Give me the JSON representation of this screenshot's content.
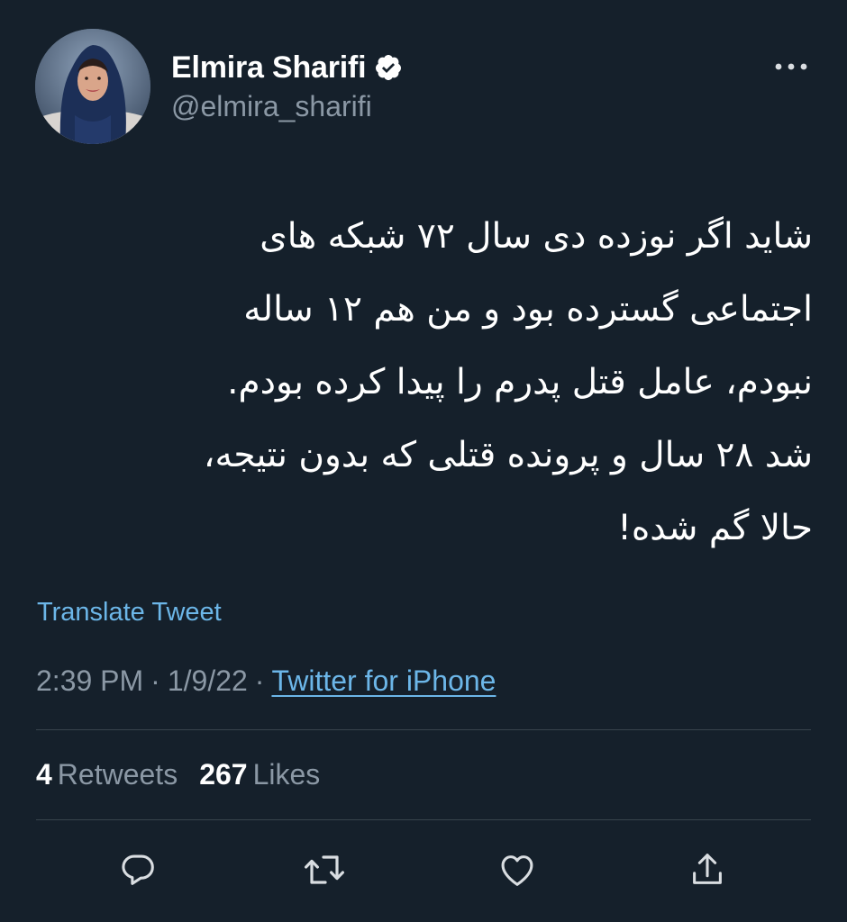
{
  "colors": {
    "background": "#15202b",
    "text_primary": "#ffffff",
    "text_secondary": "#8b98a5",
    "link": "#6cb6e8",
    "divider": "#38444d",
    "verified_badge": "#ffffff"
  },
  "author": {
    "display_name": "Elmira Sharifi",
    "handle": "@elmira_sharifi",
    "verified": true,
    "avatar_icon": "profile-photo"
  },
  "header": {
    "more_icon": "more-horizontal-icon"
  },
  "tweet": {
    "lines": [
      "شاید اگر نوزده دی سال ۷۲ شبکه های",
      "اجتماعی گسترده بود و من هم ۱۲ ساله",
      "نبودم، عامل قتل پدرم را پیدا کرده بودم.",
      "شد ۲۸ سال و پرونده قتلی که بدون نتیجه،",
      "حالا گم شده!"
    ],
    "translate_label": "Translate Tweet",
    "time": "2:39 PM",
    "separator": "·",
    "date": "1/9/22",
    "source": "Twitter for iPhone"
  },
  "stats": {
    "retweets_count": "4",
    "retweets_label": "Retweets",
    "likes_count": "267",
    "likes_label": "Likes"
  },
  "actions": {
    "reply_icon": "reply-icon",
    "retweet_icon": "retweet-icon",
    "like_icon": "heart-icon",
    "share_icon": "share-icon"
  }
}
